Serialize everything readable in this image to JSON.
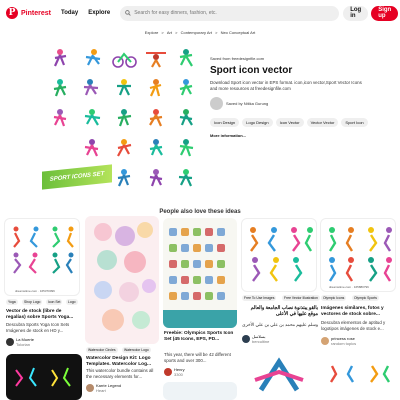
{
  "header": {
    "logo_text": "Pinterest",
    "nav": [
      "Today",
      "Explore"
    ],
    "search_placeholder": "Search for easy dinners, fashion, etc.",
    "login_label": "Log in",
    "signup_label": "Sign up",
    "colors": {
      "brand": "#e60023",
      "search_bg": "#efefef"
    }
  },
  "breadcrumb": [
    "Explore",
    ">",
    "Art",
    ">",
    "Contemporary Art",
    ">",
    "Neo Conceptual Art"
  ],
  "pin": {
    "banner_text": "SPORT ICONS SET",
    "source": "Saved from freedesignfile.com",
    "title": "Sport icon vector",
    "description": "Download Sport icon vector in EPS format. icon,icon vector,Sport Vector Icons and more resources at freedesignfile.com",
    "saved_by": "Saved by Nitika Gurung",
    "tags": [
      "Icon Design",
      "Logo Design",
      "Icon Vector",
      "Vector Vector",
      "Sport Icon"
    ],
    "more_label": "More information..."
  },
  "also_heading": "People also love these ideas",
  "cards": {
    "c1": {
      "source": "dreamstime.com · 165370096",
      "pills": [
        "Yoga",
        "Shop Logo",
        "Icon Set",
        "Logo"
      ],
      "title": "Vector de stock (libre de regalías) sobre Sports Yoga...",
      "desc": "Descubra Sports Yoga Icon Sets Imágenes de stock en HD y...",
      "user": "La Muerte",
      "user2": "Tolorian"
    },
    "c2": {
      "pills": [
        "Watercolor Circles",
        "Watercolor Logo"
      ],
      "title": "Watercolor Design Kit: Logo Templates. Watercolor Log...",
      "desc": "This watercolor bundle contains all the necessary elements for...",
      "user": "Karrie Legend",
      "user2": "Heart"
    },
    "c3": {
      "title": "Freebie: Olympics Sports Icon Set (45 Icons, EPS, PD...",
      "desc": "This year, there will be 42 different sports and over 300...",
      "user": "Henry",
      "user2": "3300"
    },
    "c4": {
      "pills": [
        "Free To Use Images",
        "Free Vector Illustration"
      ],
      "title": "بالقو يبتذنوة نصاب الجامعة والعالم موقع عليها في الأعلى",
      "desc": "وسلم عليهم محمد بن علي بن علي الأخرى",
      "user": "بسلاسل",
      "user2": "bercultine"
    },
    "c5": {
      "source": "dreamstime.com · 165880796",
      "pills": [
        "Olympic Icons",
        "Olympic Sports"
      ],
      "title": "Imágenes similares, fotos y vectores de stock sobre...",
      "desc": "Descubra elementos de aptitud y logotipos imágenes de stock e...",
      "user": "princess rose",
      "user2": "random topics"
    }
  }
}
